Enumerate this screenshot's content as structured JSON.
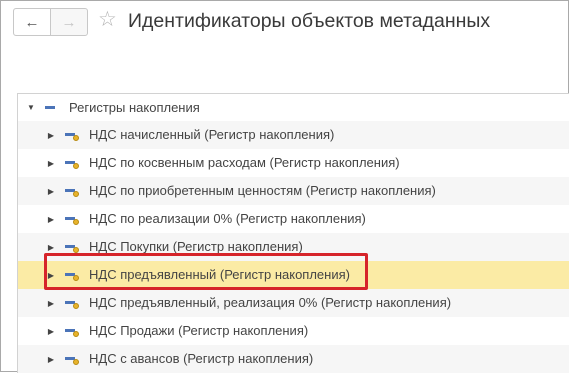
{
  "header": {
    "back_icon": "arrow-left-icon",
    "forward_icon": "arrow-right-icon",
    "favorite_icon": "star-icon",
    "title": "Идентификаторы объектов метаданных"
  },
  "tree": {
    "root": {
      "label": "Регистры накопления",
      "expanded": true,
      "icon": "register-group-icon"
    },
    "items": [
      {
        "label": "НДС начисленный (Регистр накопления)",
        "icon": "register-icon"
      },
      {
        "label": "НДС по косвенным расходам (Регистр накопления)",
        "icon": "register-icon"
      },
      {
        "label": "НДС по приобретенным ценностям (Регистр накопления)",
        "icon": "register-icon"
      },
      {
        "label": "НДС по реализации 0% (Регистр накопления)",
        "icon": "register-icon"
      },
      {
        "label": "НДС Покупки (Регистр накопления)",
        "icon": "register-icon"
      },
      {
        "label": "НДС предъявленный (Регистр накопления)",
        "icon": "register-icon",
        "selected": true,
        "highlighted": true
      },
      {
        "label": "НДС предъявленный, реализация 0% (Регистр накопления)",
        "icon": "register-icon"
      },
      {
        "label": "НДС Продажи (Регистр накопления)",
        "icon": "register-icon"
      },
      {
        "label": "НДС с авансов (Регистр накопления)",
        "icon": "register-icon"
      }
    ]
  },
  "colors": {
    "selection": "#fbeba5",
    "annotation_frame": "#d6242a",
    "register_icon": "#4b74b8",
    "register_dot": "#e8b32b"
  }
}
